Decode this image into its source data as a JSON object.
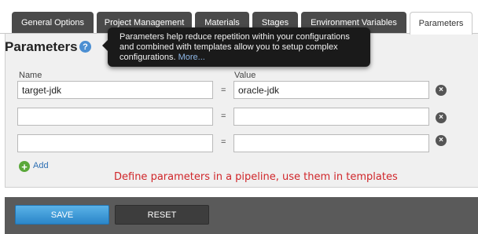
{
  "tabs": [
    {
      "label": "General Options",
      "active": false
    },
    {
      "label": "Project Management",
      "active": false
    },
    {
      "label": "Materials",
      "active": false
    },
    {
      "label": "Stages",
      "active": false
    },
    {
      "label": "Environment Variables",
      "active": false
    },
    {
      "label": "Parameters",
      "active": true
    }
  ],
  "page": {
    "title": "Parameters",
    "help_glyph": "?"
  },
  "tooltip": {
    "line1": "Parameters help reduce repetition within your configurations",
    "line2": "and combined with templates allow you to setup complex",
    "line3": "configurations. ",
    "more_link": "More..."
  },
  "table": {
    "name_header": "Name",
    "value_header": "Value",
    "equals": "=",
    "rows": [
      {
        "name": "target-jdk",
        "value": "oracle-jdk"
      },
      {
        "name": "",
        "value": ""
      },
      {
        "name": "",
        "value": ""
      }
    ],
    "remove_glyph": "×"
  },
  "add": {
    "icon_glyph": "+",
    "label": "Add"
  },
  "annotation": "Define parameters in a pipeline, use them in templates",
  "buttons": {
    "save": "SAVE",
    "reset": "RESET"
  },
  "colors": {
    "accent": "#2b86c8",
    "tab_bg": "#4a4a4a",
    "annotation": "#d0262a",
    "add": "#5aa83a"
  }
}
